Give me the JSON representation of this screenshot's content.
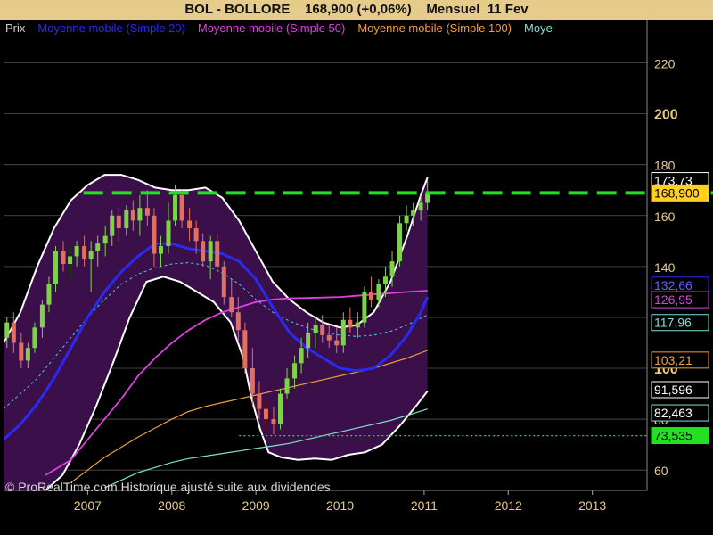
{
  "header": {
    "ticker": "BOL - BOLLORE",
    "price": "168,900 (+0,06%)",
    "period": "Mensuel  11 Fev"
  },
  "legend": [
    {
      "text": "Prix",
      "color": "#cfcfcf"
    },
    {
      "text": "Moyenne mobile (Simple 20)",
      "color": "#2a2af0"
    },
    {
      "text": "Moyenne mobile (Simple 50)",
      "color": "#e040e0"
    },
    {
      "text": "Moyenne mobile (Simple 100)",
      "color": "#f0a040"
    },
    {
      "text": "Moye",
      "color": "#80e0d0"
    }
  ],
  "footnote": "© ProRealTime.com Historique ajusté suite aux dividendes",
  "colors": {
    "background": "#000000",
    "band_fill": "#3a0f4a",
    "band_edge": "#ffffff",
    "up": "#7fd14a",
    "down": "#e07060",
    "grid": "#555555",
    "axis_text": "#e6cc8a",
    "resistance": "#22e022",
    "support": "#22e022"
  },
  "chart_data": {
    "type": "candlestick",
    "x_ticks": [
      "2007",
      "2008",
      "2009",
      "2010",
      "2011",
      "2012",
      "2013"
    ],
    "y_ticks": [
      {
        "value": 60,
        "label": "60",
        "bold": false
      },
      {
        "value": 80,
        "label": "80",
        "bold": false
      },
      {
        "value": 100,
        "label": "100",
        "bold": true
      },
      {
        "value": 120,
        "label": "120",
        "bold": false
      },
      {
        "value": 140,
        "label": "140",
        "bold": false
      },
      {
        "value": 160,
        "label": "160",
        "bold": false
      },
      {
        "value": 180,
        "label": "180",
        "bold": false
      },
      {
        "value": 200,
        "label": "200",
        "bold": true
      },
      {
        "value": 220,
        "label": "220",
        "bold": false
      }
    ],
    "xlim": [
      2006.0,
      2013.65
    ],
    "ylim": [
      52,
      237
    ],
    "candles": [
      [
        2006.04,
        112,
        120,
        108,
        118
      ],
      [
        2006.12,
        118,
        122,
        106,
        110
      ],
      [
        2006.21,
        110,
        114,
        100,
        103
      ],
      [
        2006.29,
        103,
        110,
        100,
        108
      ],
      [
        2006.37,
        108,
        118,
        106,
        116
      ],
      [
        2006.46,
        116,
        127,
        112,
        125
      ],
      [
        2006.54,
        125,
        136,
        122,
        133
      ],
      [
        2006.62,
        133,
        148,
        130,
        146
      ],
      [
        2006.71,
        146,
        150,
        138,
        141
      ],
      [
        2006.79,
        141,
        148,
        135,
        144
      ],
      [
        2006.87,
        144,
        150,
        140,
        148
      ],
      [
        2006.96,
        148,
        152,
        140,
        143
      ],
      [
        2007.04,
        143,
        150,
        130,
        146
      ],
      [
        2007.12,
        146,
        152,
        140,
        149
      ],
      [
        2007.21,
        149,
        156,
        144,
        152
      ],
      [
        2007.29,
        152,
        162,
        148,
        160
      ],
      [
        2007.37,
        160,
        163,
        150,
        155
      ],
      [
        2007.46,
        155,
        164,
        152,
        162
      ],
      [
        2007.54,
        162,
        166,
        154,
        158
      ],
      [
        2007.62,
        158,
        168,
        152,
        163
      ],
      [
        2007.71,
        163,
        170,
        156,
        160
      ],
      [
        2007.79,
        160,
        163,
        140,
        145
      ],
      [
        2007.87,
        145,
        152,
        140,
        148
      ],
      [
        2007.96,
        148,
        165,
        145,
        158
      ],
      [
        2008.04,
        158,
        172,
        156,
        168
      ],
      [
        2008.12,
        168,
        170,
        155,
        158
      ],
      [
        2008.21,
        158,
        163,
        150,
        155
      ],
      [
        2008.29,
        155,
        158,
        145,
        150
      ],
      [
        2008.37,
        150,
        153,
        140,
        142
      ],
      [
        2008.46,
        142,
        152,
        135,
        150
      ],
      [
        2008.54,
        150,
        153,
        138,
        140
      ],
      [
        2008.62,
        140,
        142,
        125,
        128
      ],
      [
        2008.71,
        128,
        135,
        120,
        122
      ],
      [
        2008.79,
        122,
        128,
        110,
        115
      ],
      [
        2008.87,
        115,
        118,
        98,
        100
      ],
      [
        2008.96,
        100,
        108,
        85,
        90
      ],
      [
        2009.04,
        90,
        95,
        80,
        84
      ],
      [
        2009.12,
        84,
        88,
        76,
        80
      ],
      [
        2009.21,
        80,
        85,
        74,
        78
      ],
      [
        2009.29,
        78,
        92,
        76,
        90
      ],
      [
        2009.37,
        90,
        100,
        88,
        96
      ],
      [
        2009.46,
        96,
        105,
        92,
        102
      ],
      [
        2009.54,
        102,
        112,
        98,
        108
      ],
      [
        2009.62,
        108,
        118,
        104,
        114
      ],
      [
        2009.71,
        114,
        120,
        108,
        117
      ],
      [
        2009.79,
        117,
        121,
        110,
        113
      ],
      [
        2009.87,
        113,
        117,
        108,
        111
      ],
      [
        2009.96,
        111,
        116,
        106,
        109
      ],
      [
        2010.04,
        109,
        122,
        106,
        119
      ],
      [
        2010.12,
        119,
        124,
        114,
        116
      ],
      [
        2010.21,
        116,
        122,
        112,
        118
      ],
      [
        2010.29,
        118,
        132,
        116,
        130
      ],
      [
        2010.37,
        130,
        136,
        124,
        127
      ],
      [
        2010.46,
        127,
        135,
        124,
        133
      ],
      [
        2010.54,
        133,
        140,
        128,
        136
      ],
      [
        2010.62,
        136,
        146,
        132,
        142
      ],
      [
        2010.71,
        142,
        160,
        140,
        157
      ],
      [
        2010.79,
        157,
        164,
        154,
        160
      ],
      [
        2010.87,
        160,
        165,
        156,
        162
      ],
      [
        2010.96,
        162,
        168,
        158,
        165
      ],
      [
        2011.04,
        165,
        174,
        162,
        168.9
      ]
    ],
    "sma20": [
      [
        2006.0,
        72
      ],
      [
        2006.2,
        78
      ],
      [
        2006.4,
        86
      ],
      [
        2006.6,
        96
      ],
      [
        2006.8,
        108
      ],
      [
        2007.0,
        120
      ],
      [
        2007.2,
        130
      ],
      [
        2007.4,
        138
      ],
      [
        2007.6,
        144
      ],
      [
        2007.8,
        149
      ],
      [
        2008.0,
        149
      ],
      [
        2008.2,
        147
      ],
      [
        2008.4,
        146
      ],
      [
        2008.6,
        145
      ],
      [
        2008.8,
        142
      ],
      [
        2009.0,
        135
      ],
      [
        2009.2,
        124
      ],
      [
        2009.4,
        114
      ],
      [
        2009.6,
        108
      ],
      [
        2009.8,
        104
      ],
      [
        2010.0,
        100
      ],
      [
        2010.2,
        99
      ],
      [
        2010.4,
        100
      ],
      [
        2010.6,
        105
      ],
      [
        2010.8,
        113
      ],
      [
        2010.96,
        122
      ],
      [
        2011.04,
        128
      ]
    ],
    "sma50": [
      [
        2006.5,
        58
      ],
      [
        2006.8,
        64
      ],
      [
        2007.0,
        72
      ],
      [
        2007.2,
        80
      ],
      [
        2007.4,
        88
      ],
      [
        2007.6,
        97
      ],
      [
        2007.8,
        104
      ],
      [
        2008.0,
        110
      ],
      [
        2008.2,
        115
      ],
      [
        2008.4,
        119
      ],
      [
        2008.6,
        122
      ],
      [
        2008.8,
        124
      ],
      [
        2009.0,
        126
      ],
      [
        2009.2,
        127
      ],
      [
        2009.4,
        127.5
      ],
      [
        2009.6,
        127.6
      ],
      [
        2009.8,
        127.8
      ],
      [
        2010.0,
        128
      ],
      [
        2010.2,
        128.5
      ],
      [
        2010.4,
        129
      ],
      [
        2010.6,
        129.5
      ],
      [
        2010.8,
        130
      ],
      [
        2011.04,
        130.5
      ]
    ],
    "sma100": [
      [
        2006.8,
        55
      ],
      [
        2007.0,
        60
      ],
      [
        2007.2,
        65
      ],
      [
        2007.4,
        69
      ],
      [
        2007.6,
        73
      ],
      [
        2007.8,
        76.5
      ],
      [
        2008.0,
        80
      ],
      [
        2008.2,
        83
      ],
      [
        2008.4,
        85
      ],
      [
        2008.6,
        86.5
      ],
      [
        2008.8,
        88
      ],
      [
        2009.0,
        89.5
      ],
      [
        2009.2,
        91
      ],
      [
        2009.4,
        92.5
      ],
      [
        2009.6,
        94
      ],
      [
        2009.8,
        95.5
      ],
      [
        2010.0,
        97
      ],
      [
        2010.2,
        98.5
      ],
      [
        2010.4,
        100
      ],
      [
        2010.6,
        102
      ],
      [
        2010.8,
        104
      ],
      [
        2011.04,
        107
      ]
    ],
    "sma150": [
      [
        2007.2,
        53
      ],
      [
        2007.4,
        56
      ],
      [
        2007.6,
        59
      ],
      [
        2007.8,
        61
      ],
      [
        2008.0,
        63
      ],
      [
        2008.2,
        64.5
      ],
      [
        2008.4,
        65.5
      ],
      [
        2008.6,
        66.5
      ],
      [
        2008.8,
        67.5
      ],
      [
        2009.0,
        68.5
      ],
      [
        2009.2,
        69.5
      ],
      [
        2009.4,
        70.5
      ],
      [
        2009.6,
        72
      ],
      [
        2009.8,
        73.5
      ],
      [
        2010.0,
        75
      ],
      [
        2010.2,
        76.5
      ],
      [
        2010.4,
        78
      ],
      [
        2010.6,
        79.5
      ],
      [
        2010.8,
        81.5
      ],
      [
        2011.04,
        84
      ]
    ],
    "mid_dashed": [
      [
        2006.0,
        84
      ],
      [
        2006.2,
        90
      ],
      [
        2006.4,
        96
      ],
      [
        2006.6,
        104
      ],
      [
        2006.8,
        112
      ],
      [
        2007.0,
        120
      ],
      [
        2007.2,
        127
      ],
      [
        2007.4,
        133
      ],
      [
        2007.6,
        137
      ],
      [
        2007.8,
        139.5
      ],
      [
        2008.0,
        141
      ],
      [
        2008.2,
        141.5
      ],
      [
        2008.4,
        140.5
      ],
      [
        2008.6,
        137.5
      ],
      [
        2008.8,
        133
      ],
      [
        2009.0,
        127
      ],
      [
        2009.2,
        122
      ],
      [
        2009.4,
        118.5
      ],
      [
        2009.6,
        116
      ],
      [
        2009.8,
        114
      ],
      [
        2010.0,
        113
      ],
      [
        2010.2,
        112.5
      ],
      [
        2010.4,
        113
      ],
      [
        2010.6,
        114.5
      ],
      [
        2010.8,
        117
      ],
      [
        2011.04,
        121
      ]
    ],
    "band_upper": [
      [
        2006.0,
        110
      ],
      [
        2006.2,
        122
      ],
      [
        2006.4,
        140
      ],
      [
        2006.6,
        155
      ],
      [
        2006.8,
        166
      ],
      [
        2007.0,
        172
      ],
      [
        2007.2,
        176
      ],
      [
        2007.4,
        176
      ],
      [
        2007.6,
        174
      ],
      [
        2007.8,
        171
      ],
      [
        2008.0,
        170
      ],
      [
        2008.2,
        170
      ],
      [
        2008.4,
        171
      ],
      [
        2008.6,
        167
      ],
      [
        2008.8,
        158
      ],
      [
        2009.0,
        146
      ],
      [
        2009.2,
        134
      ],
      [
        2009.4,
        127
      ],
      [
        2009.6,
        122
      ],
      [
        2009.8,
        118
      ],
      [
        2010.0,
        116
      ],
      [
        2010.2,
        117
      ],
      [
        2010.4,
        122
      ],
      [
        2010.6,
        134
      ],
      [
        2010.8,
        152
      ],
      [
        2010.96,
        168
      ],
      [
        2011.04,
        175
      ]
    ],
    "band_lower": [
      [
        2006.5,
        52
      ],
      [
        2006.7,
        58
      ],
      [
        2006.9,
        70
      ],
      [
        2007.1,
        85
      ],
      [
        2007.3,
        102
      ],
      [
        2007.5,
        120
      ],
      [
        2007.7,
        134
      ],
      [
        2007.9,
        136
      ],
      [
        2008.1,
        134
      ],
      [
        2008.3,
        130
      ],
      [
        2008.5,
        126
      ],
      [
        2008.7,
        118
      ],
      [
        2008.85,
        104
      ],
      [
        2008.95,
        88
      ],
      [
        2009.05,
        76
      ],
      [
        2009.15,
        67
      ],
      [
        2009.3,
        65
      ],
      [
        2009.5,
        64
      ],
      [
        2009.7,
        64.5
      ],
      [
        2009.9,
        64
      ],
      [
        2010.1,
        66
      ],
      [
        2010.3,
        67
      ],
      [
        2010.5,
        70
      ],
      [
        2010.7,
        77
      ],
      [
        2010.9,
        85
      ],
      [
        2011.04,
        91
      ]
    ],
    "resistance_level": 168.9,
    "resistance_from": 2006.95,
    "support_level": 73.5,
    "support_from": 2008.8,
    "price_labels": [
      {
        "value": 173.73,
        "text": "173,73",
        "color": "#ffffff",
        "bg": "#000000",
        "fg": "#ffffff"
      },
      {
        "value": 168.9,
        "text": "168,900",
        "color": "#ffd020",
        "bg": "#ffd020",
        "fg": "#000000"
      },
      {
        "value": 132.66,
        "text": "132,66",
        "color": "#2a2af0",
        "bg": "#000000",
        "fg": "#6060ff"
      },
      {
        "value": 126.95,
        "text": "126,95",
        "color": "#e040e0",
        "bg": "#000000",
        "fg": "#e040e0"
      },
      {
        "value": 117.96,
        "text": "117,96",
        "color": "#80e0d0",
        "bg": "#000000",
        "fg": "#80e0d0"
      },
      {
        "value": 103.21,
        "text": "103,21",
        "color": "#f0a040",
        "bg": "#000000",
        "fg": "#f0a040"
      },
      {
        "value": 91.596,
        "text": "91,596",
        "color": "#ffffff",
        "bg": "#000000",
        "fg": "#ffffff"
      },
      {
        "value": 82.463,
        "text": "82,463",
        "color": "#80e0d0",
        "bg": "#000000",
        "fg": "#ffffff"
      },
      {
        "value": 73.535,
        "text": "73,535",
        "color": "#22e022",
        "bg": "#22e022",
        "fg": "#000000"
      }
    ]
  }
}
